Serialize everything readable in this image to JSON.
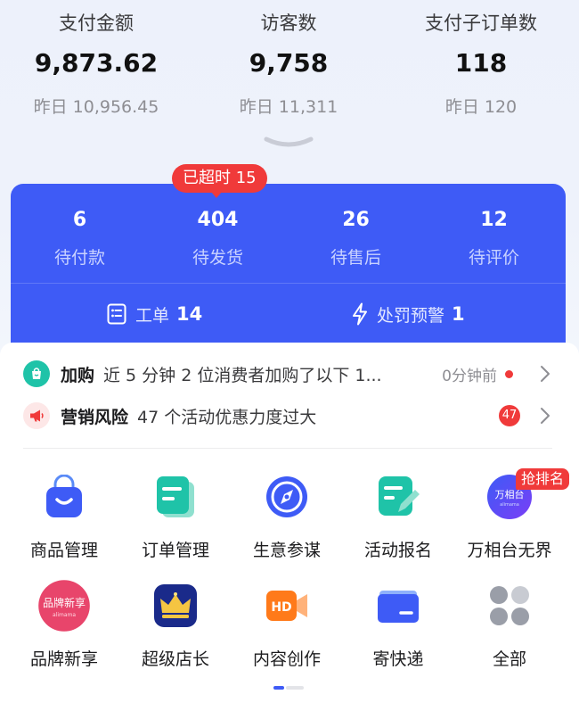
{
  "stats": [
    {
      "label": "支付金额",
      "value": "9,873.62",
      "yesterday": "昨日 10,956.45"
    },
    {
      "label": "访客数",
      "value": "9,758",
      "yesterday": "昨日 11,311"
    },
    {
      "label": "支付子订单数",
      "value": "118",
      "yesterday": "昨日 120"
    }
  ],
  "orders": {
    "timeout_badge": "已超时 15",
    "items": [
      {
        "count": "6",
        "label": "待付款"
      },
      {
        "count": "404",
        "label": "待发货"
      },
      {
        "count": "26",
        "label": "待售后"
      },
      {
        "count": "12",
        "label": "待评价"
      }
    ],
    "ticket_label": "工单",
    "ticket_count": "14",
    "penalty_label": "处罚预警",
    "penalty_count": "1"
  },
  "notices": [
    {
      "icon": "bag-icon",
      "title": "加购",
      "text": "近 5 分钟 2 位消费者加购了以下 1...",
      "time": "0分钟前"
    },
    {
      "icon": "megaphone-icon",
      "title": "营销风险",
      "text": "47 个活动优惠力度过大",
      "badge": "47"
    }
  ],
  "tools": [
    {
      "label": "商品管理",
      "icon": "shopping-bag-icon"
    },
    {
      "label": "订单管理",
      "icon": "order-doc-icon"
    },
    {
      "label": "生意参谋",
      "icon": "compass-icon"
    },
    {
      "label": "活动报名",
      "icon": "edit-doc-icon"
    },
    {
      "label": "万相台无界",
      "icon": "wanxiangtai-logo",
      "badge": "抢排名"
    },
    {
      "label": "品牌新享",
      "icon": "brand-logo"
    },
    {
      "label": "超级店长",
      "icon": "crown-icon"
    },
    {
      "label": "内容创作",
      "icon": "hd-camera-icon"
    },
    {
      "label": "寄快递",
      "icon": "express-box-icon"
    },
    {
      "label": "全部",
      "icon": "all-dots-icon"
    }
  ],
  "colors": {
    "accent": "#3e5bf6",
    "alert": "#f03a3a",
    "teal": "#1fc3a8"
  }
}
